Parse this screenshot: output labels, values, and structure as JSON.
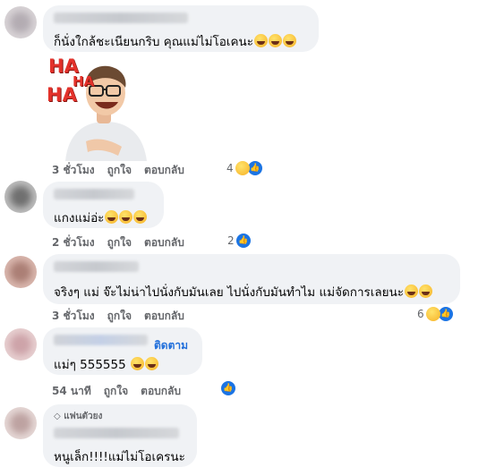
{
  "comments": [
    {
      "text": "ก็นั่งใกล้ชะเนียนกริบ คุณแม่ไม่โอเคนะ",
      "emojis": [
        "laughing-emoji",
        "laughing-emoji",
        "laughing-emoji"
      ],
      "time": "3 ชั่วโมง",
      "like_label": "ถูกใจ",
      "reply_label": "ตอบกลับ",
      "reaction_count": "4",
      "sticker": {
        "text1": "HA",
        "text2": "HA",
        "text3": "HA"
      }
    },
    {
      "text": "แกงแม่อ่ะ",
      "time": "2 ชั่วโมง",
      "like_label": "ถูกใจ",
      "reply_label": "ตอบกลับ",
      "reaction_count": "2"
    },
    {
      "text": "จริงๆ แม่ จ๊ะไม่น่าไปนั่งกับมันเลย ไปนั่งกับมันทำไม แม่จัดการเลยนะ",
      "time": "3 ชั่วโมง",
      "like_label": "ถูกใจ",
      "reply_label": "ตอบกลับ",
      "reaction_count": "6"
    },
    {
      "follow_label": "ติดตาม",
      "text": "แม่ๆ 555555",
      "time": "54 นาที",
      "like_label": "ถูกใจ",
      "reply_label": "ตอบกลับ"
    },
    {
      "badge": "แฟนตัวยง",
      "text": "หนูเล็ก!!!!แม่ไม่โอเครนะ"
    }
  ],
  "colors": {
    "bubble": "#f0f2f5",
    "meta": "#65676b",
    "link": "#216fdb",
    "like": "#1b74e4"
  }
}
